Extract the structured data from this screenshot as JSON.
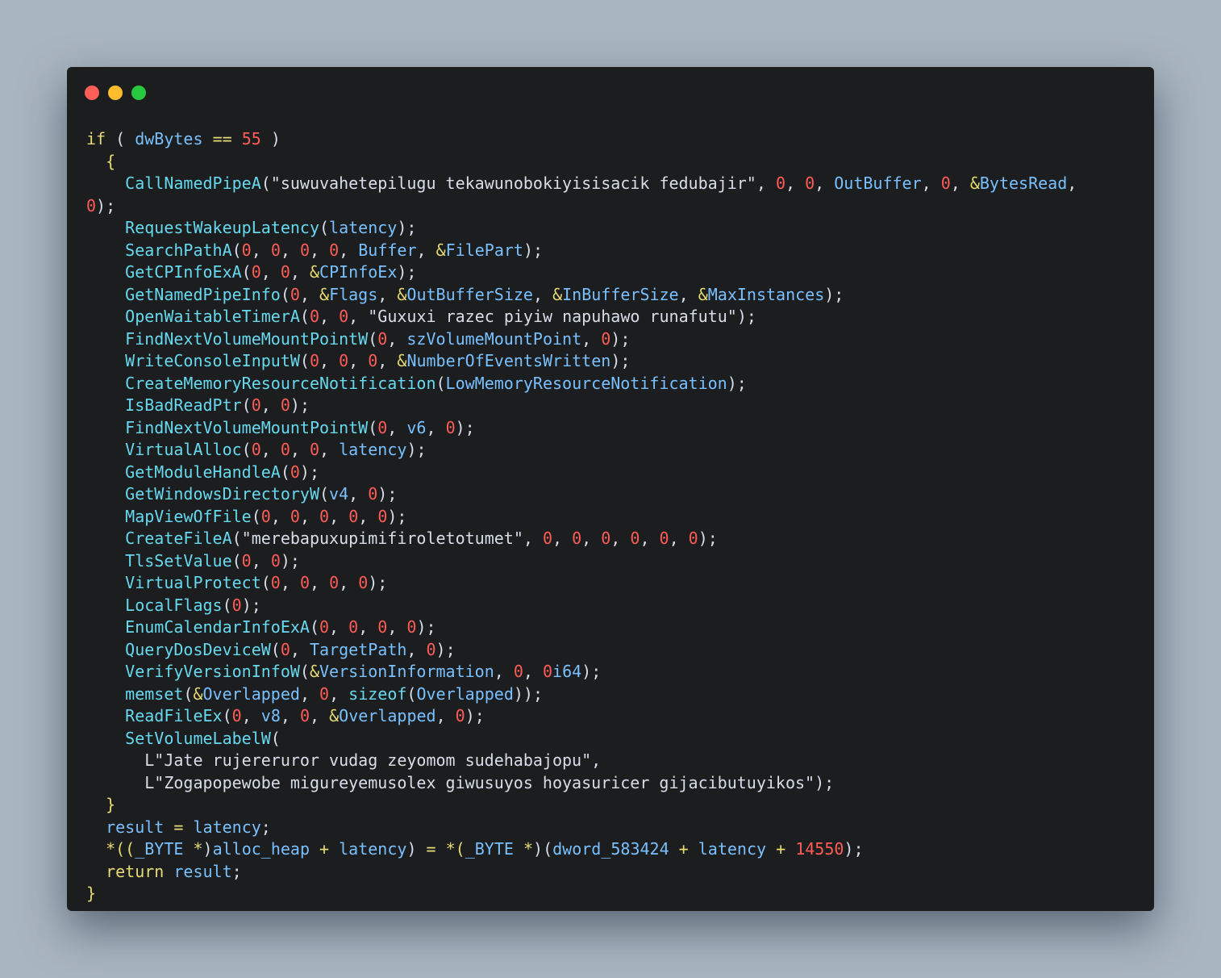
{
  "window": {
    "controls": [
      {
        "name": "close",
        "color": "#ff5f57"
      },
      {
        "name": "minimize",
        "color": "#febc2e"
      },
      {
        "name": "zoom",
        "color": "#28c840"
      }
    ]
  },
  "colors": {
    "background": "#a9b5c1",
    "editor": "#1c1d1f",
    "keyword": "#e6db74",
    "function": "#66d9ef",
    "variable": "#79c0ff",
    "number": "#ff5c57",
    "string": "#d8dee9"
  },
  "code": {
    "lines": [
      [
        [
          "kw",
          "if"
        ],
        [
          "pun",
          " ( "
        ],
        [
          "var",
          "dwBytes"
        ],
        [
          "pun",
          " "
        ],
        [
          "op",
          "=="
        ],
        [
          "pun",
          " "
        ],
        [
          "num",
          "55"
        ],
        [
          "pun",
          " )"
        ]
      ],
      [
        [
          "pun",
          "  "
        ],
        [
          "kw",
          "{"
        ]
      ],
      [
        [
          "pun",
          "    "
        ],
        [
          "fn",
          "CallNamedPipeA"
        ],
        [
          "pun",
          "("
        ],
        [
          "str",
          "\"suwuvahetepilugu tekawunobokiyisisacik fedubajir\""
        ],
        [
          "pun",
          ", "
        ],
        [
          "num",
          "0"
        ],
        [
          "pun",
          ", "
        ],
        [
          "num",
          "0"
        ],
        [
          "pun",
          ", "
        ],
        [
          "var",
          "OutBuffer"
        ],
        [
          "pun",
          ", "
        ],
        [
          "num",
          "0"
        ],
        [
          "pun",
          ", "
        ],
        [
          "op",
          "&"
        ],
        [
          "var",
          "BytesRead"
        ],
        [
          "pun",
          ","
        ]
      ],
      [
        [
          "num",
          "0"
        ],
        [
          "pun",
          ");"
        ]
      ],
      [
        [
          "pun",
          "    "
        ],
        [
          "fn",
          "RequestWakeupLatency"
        ],
        [
          "pun",
          "("
        ],
        [
          "var",
          "latency"
        ],
        [
          "pun",
          ");"
        ]
      ],
      [
        [
          "pun",
          "    "
        ],
        [
          "fn",
          "SearchPathA"
        ],
        [
          "pun",
          "("
        ],
        [
          "num",
          "0"
        ],
        [
          "pun",
          ", "
        ],
        [
          "num",
          "0"
        ],
        [
          "pun",
          ", "
        ],
        [
          "num",
          "0"
        ],
        [
          "pun",
          ", "
        ],
        [
          "num",
          "0"
        ],
        [
          "pun",
          ", "
        ],
        [
          "var",
          "Buffer"
        ],
        [
          "pun",
          ", "
        ],
        [
          "op",
          "&"
        ],
        [
          "var",
          "FilePart"
        ],
        [
          "pun",
          ");"
        ]
      ],
      [
        [
          "pun",
          "    "
        ],
        [
          "fn",
          "GetCPInfoExA"
        ],
        [
          "pun",
          "("
        ],
        [
          "num",
          "0"
        ],
        [
          "pun",
          ", "
        ],
        [
          "num",
          "0"
        ],
        [
          "pun",
          ", "
        ],
        [
          "op",
          "&"
        ],
        [
          "var",
          "CPInfoEx"
        ],
        [
          "pun",
          ");"
        ]
      ],
      [
        [
          "pun",
          "    "
        ],
        [
          "fn",
          "GetNamedPipeInfo"
        ],
        [
          "pun",
          "("
        ],
        [
          "num",
          "0"
        ],
        [
          "pun",
          ", "
        ],
        [
          "op",
          "&"
        ],
        [
          "var",
          "Flags"
        ],
        [
          "pun",
          ", "
        ],
        [
          "op",
          "&"
        ],
        [
          "var",
          "OutBufferSize"
        ],
        [
          "pun",
          ", "
        ],
        [
          "op",
          "&"
        ],
        [
          "var",
          "InBufferSize"
        ],
        [
          "pun",
          ", "
        ],
        [
          "op",
          "&"
        ],
        [
          "var",
          "MaxInstances"
        ],
        [
          "pun",
          ");"
        ]
      ],
      [
        [
          "pun",
          "    "
        ],
        [
          "fn",
          "OpenWaitableTimerA"
        ],
        [
          "pun",
          "("
        ],
        [
          "num",
          "0"
        ],
        [
          "pun",
          ", "
        ],
        [
          "num",
          "0"
        ],
        [
          "pun",
          ", "
        ],
        [
          "str",
          "\"Guxuxi razec piyiw napuhawo runafutu\""
        ],
        [
          "pun",
          ");"
        ]
      ],
      [
        [
          "pun",
          "    "
        ],
        [
          "fn",
          "FindNextVolumeMountPointW"
        ],
        [
          "pun",
          "("
        ],
        [
          "num",
          "0"
        ],
        [
          "pun",
          ", "
        ],
        [
          "var",
          "szVolumeMountPoint"
        ],
        [
          "pun",
          ", "
        ],
        [
          "num",
          "0"
        ],
        [
          "pun",
          ");"
        ]
      ],
      [
        [
          "pun",
          "    "
        ],
        [
          "fn",
          "WriteConsoleInputW"
        ],
        [
          "pun",
          "("
        ],
        [
          "num",
          "0"
        ],
        [
          "pun",
          ", "
        ],
        [
          "num",
          "0"
        ],
        [
          "pun",
          ", "
        ],
        [
          "num",
          "0"
        ],
        [
          "pun",
          ", "
        ],
        [
          "op",
          "&"
        ],
        [
          "var",
          "NumberOfEventsWritten"
        ],
        [
          "pun",
          ");"
        ]
      ],
      [
        [
          "pun",
          "    "
        ],
        [
          "fn",
          "CreateMemoryResourceNotification"
        ],
        [
          "pun",
          "("
        ],
        [
          "var",
          "LowMemoryResourceNotification"
        ],
        [
          "pun",
          ");"
        ]
      ],
      [
        [
          "pun",
          "    "
        ],
        [
          "fn",
          "IsBadReadPtr"
        ],
        [
          "pun",
          "("
        ],
        [
          "num",
          "0"
        ],
        [
          "pun",
          ", "
        ],
        [
          "num",
          "0"
        ],
        [
          "pun",
          ");"
        ]
      ],
      [
        [
          "pun",
          "    "
        ],
        [
          "fn",
          "FindNextVolumeMountPointW"
        ],
        [
          "pun",
          "("
        ],
        [
          "num",
          "0"
        ],
        [
          "pun",
          ", "
        ],
        [
          "var",
          "v6"
        ],
        [
          "pun",
          ", "
        ],
        [
          "num",
          "0"
        ],
        [
          "pun",
          ");"
        ]
      ],
      [
        [
          "pun",
          "    "
        ],
        [
          "fn",
          "VirtualAlloc"
        ],
        [
          "pun",
          "("
        ],
        [
          "num",
          "0"
        ],
        [
          "pun",
          ", "
        ],
        [
          "num",
          "0"
        ],
        [
          "pun",
          ", "
        ],
        [
          "num",
          "0"
        ],
        [
          "pun",
          ", "
        ],
        [
          "var",
          "latency"
        ],
        [
          "pun",
          ");"
        ]
      ],
      [
        [
          "pun",
          "    "
        ],
        [
          "fn",
          "GetModuleHandleA"
        ],
        [
          "pun",
          "("
        ],
        [
          "num",
          "0"
        ],
        [
          "pun",
          ");"
        ]
      ],
      [
        [
          "pun",
          "    "
        ],
        [
          "fn",
          "GetWindowsDirectoryW"
        ],
        [
          "pun",
          "("
        ],
        [
          "var",
          "v4"
        ],
        [
          "pun",
          ", "
        ],
        [
          "num",
          "0"
        ],
        [
          "pun",
          ");"
        ]
      ],
      [
        [
          "pun",
          "    "
        ],
        [
          "fn",
          "MapViewOfFile"
        ],
        [
          "pun",
          "("
        ],
        [
          "num",
          "0"
        ],
        [
          "pun",
          ", "
        ],
        [
          "num",
          "0"
        ],
        [
          "pun",
          ", "
        ],
        [
          "num",
          "0"
        ],
        [
          "pun",
          ", "
        ],
        [
          "num",
          "0"
        ],
        [
          "pun",
          ", "
        ],
        [
          "num",
          "0"
        ],
        [
          "pun",
          ");"
        ]
      ],
      [
        [
          "pun",
          "    "
        ],
        [
          "fn",
          "CreateFileA"
        ],
        [
          "pun",
          "("
        ],
        [
          "str",
          "\"merebapuxupimifiroletotumet\""
        ],
        [
          "pun",
          ", "
        ],
        [
          "num",
          "0"
        ],
        [
          "pun",
          ", "
        ],
        [
          "num",
          "0"
        ],
        [
          "pun",
          ", "
        ],
        [
          "num",
          "0"
        ],
        [
          "pun",
          ", "
        ],
        [
          "num",
          "0"
        ],
        [
          "pun",
          ", "
        ],
        [
          "num",
          "0"
        ],
        [
          "pun",
          ", "
        ],
        [
          "num",
          "0"
        ],
        [
          "pun",
          ");"
        ]
      ],
      [
        [
          "pun",
          "    "
        ],
        [
          "fn",
          "TlsSetValue"
        ],
        [
          "pun",
          "("
        ],
        [
          "num",
          "0"
        ],
        [
          "pun",
          ", "
        ],
        [
          "num",
          "0"
        ],
        [
          "pun",
          ");"
        ]
      ],
      [
        [
          "pun",
          "    "
        ],
        [
          "fn",
          "VirtualProtect"
        ],
        [
          "pun",
          "("
        ],
        [
          "num",
          "0"
        ],
        [
          "pun",
          ", "
        ],
        [
          "num",
          "0"
        ],
        [
          "pun",
          ", "
        ],
        [
          "num",
          "0"
        ],
        [
          "pun",
          ", "
        ],
        [
          "num",
          "0"
        ],
        [
          "pun",
          ");"
        ]
      ],
      [
        [
          "pun",
          "    "
        ],
        [
          "fn",
          "LocalFlags"
        ],
        [
          "pun",
          "("
        ],
        [
          "num",
          "0"
        ],
        [
          "pun",
          ");"
        ]
      ],
      [
        [
          "pun",
          "    "
        ],
        [
          "fn",
          "EnumCalendarInfoExA"
        ],
        [
          "pun",
          "("
        ],
        [
          "num",
          "0"
        ],
        [
          "pun",
          ", "
        ],
        [
          "num",
          "0"
        ],
        [
          "pun",
          ", "
        ],
        [
          "num",
          "0"
        ],
        [
          "pun",
          ", "
        ],
        [
          "num",
          "0"
        ],
        [
          "pun",
          ");"
        ]
      ],
      [
        [
          "pun",
          "    "
        ],
        [
          "fn",
          "QueryDosDeviceW"
        ],
        [
          "pun",
          "("
        ],
        [
          "num",
          "0"
        ],
        [
          "pun",
          ", "
        ],
        [
          "var",
          "TargetPath"
        ],
        [
          "pun",
          ", "
        ],
        [
          "num",
          "0"
        ],
        [
          "pun",
          ");"
        ]
      ],
      [
        [
          "pun",
          "    "
        ],
        [
          "fn",
          "VerifyVersionInfoW"
        ],
        [
          "pun",
          "("
        ],
        [
          "op",
          "&"
        ],
        [
          "var",
          "VersionInformation"
        ],
        [
          "pun",
          ", "
        ],
        [
          "num",
          "0"
        ],
        [
          "pun",
          ", "
        ],
        [
          "num",
          "0"
        ],
        [
          "var",
          "i64"
        ],
        [
          "pun",
          ");"
        ]
      ],
      [
        [
          "pun",
          "    "
        ],
        [
          "fn",
          "memset"
        ],
        [
          "pun",
          "("
        ],
        [
          "op",
          "&"
        ],
        [
          "var",
          "Overlapped"
        ],
        [
          "pun",
          ", "
        ],
        [
          "num",
          "0"
        ],
        [
          "pun",
          ", "
        ],
        [
          "fn",
          "sizeof"
        ],
        [
          "pun",
          "("
        ],
        [
          "var",
          "Overlapped"
        ],
        [
          "pun",
          "));"
        ]
      ],
      [
        [
          "pun",
          "    "
        ],
        [
          "fn",
          "ReadFileEx"
        ],
        [
          "pun",
          "("
        ],
        [
          "num",
          "0"
        ],
        [
          "pun",
          ", "
        ],
        [
          "var",
          "v8"
        ],
        [
          "pun",
          ", "
        ],
        [
          "num",
          "0"
        ],
        [
          "pun",
          ", "
        ],
        [
          "op",
          "&"
        ],
        [
          "var",
          "Overlapped"
        ],
        [
          "pun",
          ", "
        ],
        [
          "num",
          "0"
        ],
        [
          "pun",
          ");"
        ]
      ],
      [
        [
          "pun",
          "    "
        ],
        [
          "fn",
          "SetVolumeLabelW"
        ],
        [
          "pun",
          "("
        ]
      ],
      [
        [
          "pun",
          "      "
        ],
        [
          "str",
          "L\"Jate rujereruror vudag zeyomom sudehabajopu\""
        ],
        [
          "pun",
          ","
        ]
      ],
      [
        [
          "pun",
          "      "
        ],
        [
          "str",
          "L\"Zogapopewobe migureyemusolex giwusuyos hoyasuricer gijacibutuyikos\""
        ],
        [
          "pun",
          ");"
        ]
      ],
      [
        [
          "pun",
          "  "
        ],
        [
          "kw",
          "}"
        ]
      ],
      [
        [
          "pun",
          "  "
        ],
        [
          "var",
          "result"
        ],
        [
          "pun",
          " "
        ],
        [
          "op",
          "="
        ],
        [
          "pun",
          " "
        ],
        [
          "var",
          "latency"
        ],
        [
          "pun",
          ";"
        ]
      ],
      [
        [
          "pun",
          "  "
        ],
        [
          "op",
          "*(("
        ],
        [
          "ty",
          "_BYTE"
        ],
        [
          "pun",
          " "
        ],
        [
          "op",
          "*"
        ],
        [
          "pun",
          ")"
        ],
        [
          "var",
          "alloc_heap"
        ],
        [
          "pun",
          " "
        ],
        [
          "op",
          "+"
        ],
        [
          "pun",
          " "
        ],
        [
          "var",
          "latency"
        ],
        [
          "pun",
          ") "
        ],
        [
          "op",
          "="
        ],
        [
          "pun",
          " "
        ],
        [
          "op",
          "*("
        ],
        [
          "ty",
          "_BYTE"
        ],
        [
          "pun",
          " "
        ],
        [
          "op",
          "*"
        ],
        [
          "pun",
          ")("
        ],
        [
          "var",
          "dword_583424"
        ],
        [
          "pun",
          " "
        ],
        [
          "op",
          "+"
        ],
        [
          "pun",
          " "
        ],
        [
          "var",
          "latency"
        ],
        [
          "pun",
          " "
        ],
        [
          "op",
          "+"
        ],
        [
          "pun",
          " "
        ],
        [
          "num",
          "14550"
        ],
        [
          "pun",
          ");"
        ]
      ],
      [
        [
          "pun",
          "  "
        ],
        [
          "kw",
          "return"
        ],
        [
          "pun",
          " "
        ],
        [
          "var",
          "result"
        ],
        [
          "pun",
          ";"
        ]
      ],
      [
        [
          "kw",
          "}"
        ]
      ]
    ]
  }
}
